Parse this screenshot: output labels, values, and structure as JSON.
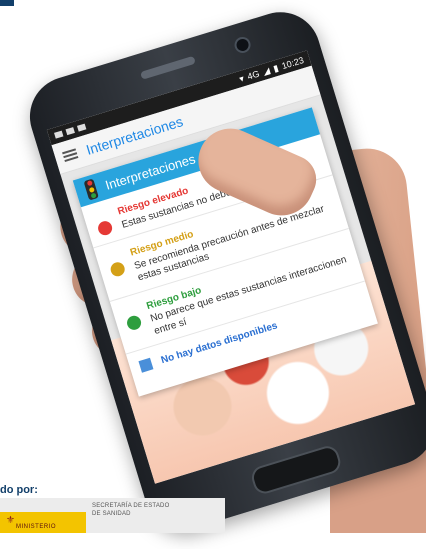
{
  "status_bar": {
    "network": "4G",
    "time": "10:23"
  },
  "app_bar": {
    "title": "Interpretaciones"
  },
  "card": {
    "title": "Interpretaciones",
    "risks": [
      {
        "title": "Riesgo elevado",
        "description": "Estas sustancias no deben mezclarse",
        "color": "#e53935"
      },
      {
        "title": "Riesgo medio",
        "description": "Se recomienda precaución antes de mezclar estas sustancias",
        "color": "#d4a017"
      },
      {
        "title": "Riesgo bajo",
        "description": "No parece que estas sustancias interaccionen entre sí",
        "color": "#2e9e3e"
      }
    ],
    "no_data": {
      "label": "No hay datos disponibles",
      "color": "#4a8fd9"
    }
  },
  "footer": {
    "credit_label": "do por:",
    "ministry_name": "MINISTERIO",
    "secretaria_line1": "SECRETARÍA DE ESTADO",
    "secretaria_line2": "DE SANIDAD"
  }
}
